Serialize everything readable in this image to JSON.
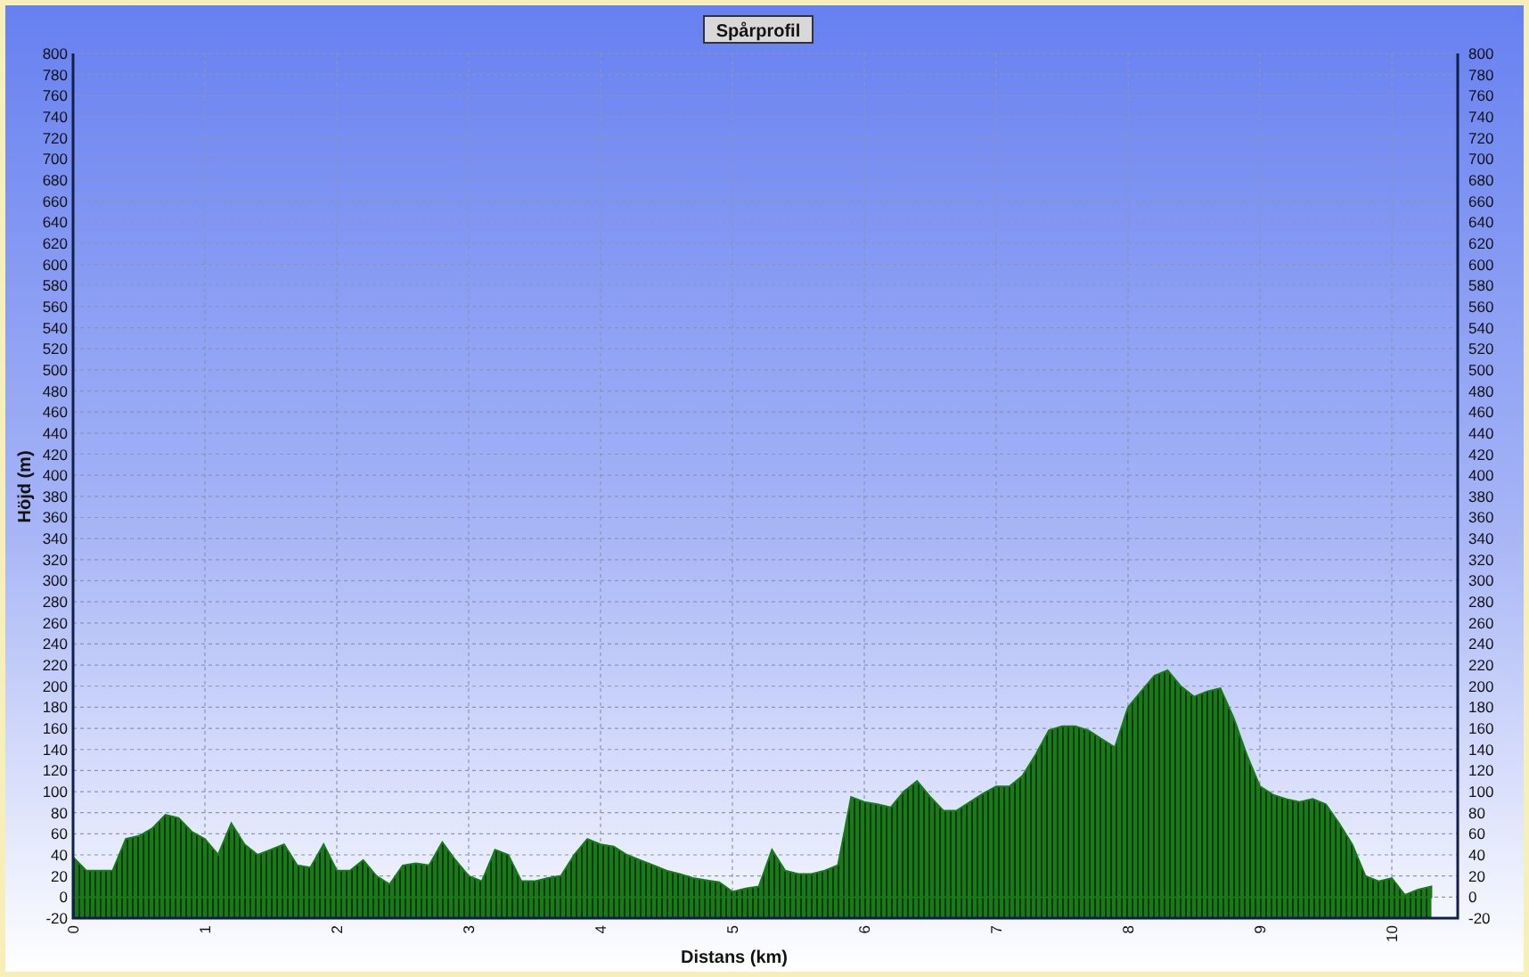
{
  "chart": {
    "right_axis_labels": [
      "800",
      "780",
      "760",
      "740",
      "720",
      "700",
      "680",
      "660",
      "640",
      "620",
      "600",
      "580",
      "560",
      "540",
      "520",
      "500",
      "480",
      "460",
      "440",
      "420",
      "400",
      "380",
      "360",
      "340",
      "320",
      "300",
      "280",
      "260",
      "240",
      "220",
      "200",
      "180",
      "160",
      "140",
      "120",
      "100",
      "80",
      "60",
      "40",
      "20",
      "0",
      "-20"
    ],
    "chart_data": {
      "type": "area",
      "title": "Spårprofil",
      "xlabel": "Distans (km)",
      "ylabel": "Höjd (m)",
      "x": [
        0,
        0.1,
        0.2,
        0.3,
        0.4,
        0.5,
        0.6,
        0.7,
        0.8,
        0.9,
        1,
        1.1,
        1.2,
        1.3,
        1.4,
        1.5,
        1.6,
        1.7,
        1.8,
        1.9,
        2,
        2.1,
        2.2,
        2.3,
        2.4,
        2.5,
        2.6,
        2.7,
        2.8,
        2.9,
        3,
        3.1,
        3.2,
        3.3,
        3.4,
        3.5,
        3.6,
        3.7,
        3.8,
        3.9,
        4,
        4.1,
        4.2,
        4.3,
        4.4,
        4.5,
        4.6,
        4.7,
        4.8,
        4.9,
        5,
        5.1,
        5.2,
        5.3,
        5.4,
        5.5,
        5.6,
        5.7,
        5.8,
        5.9,
        6,
        6.1,
        6.2,
        6.3,
        6.4,
        6.5,
        6.6,
        6.7,
        6.8,
        6.9,
        7,
        7.1,
        7.2,
        7.3,
        7.4,
        7.5,
        7.6,
        7.7,
        7.8,
        7.9,
        8,
        8.1,
        8.2,
        8.3,
        8.4,
        8.5,
        8.6,
        8.7,
        8.8,
        8.9,
        9,
        9.1,
        9.2,
        9.3,
        9.4,
        9.5,
        9.6,
        9.7,
        9.8,
        9.9,
        10,
        10.1,
        10.2,
        10.3
      ],
      "series": [
        {
          "color": "#1a7a1a",
          "values": [
            38,
            25,
            25,
            25,
            55,
            58,
            65,
            78,
            75,
            62,
            55,
            40,
            70,
            50,
            40,
            45,
            50,
            30,
            28,
            50,
            25,
            25,
            35,
            20,
            12,
            30,
            32,
            30,
            52,
            35,
            20,
            15,
            45,
            40,
            15,
            15,
            18,
            20,
            40,
            55,
            50,
            48,
            40,
            35,
            30,
            25,
            22,
            18,
            16,
            14,
            5,
            8,
            10,
            45,
            25,
            22,
            22,
            25,
            30,
            95,
            90,
            88,
            85,
            100,
            110,
            95,
            82,
            82,
            90,
            98,
            105,
            105,
            115,
            135,
            158,
            162,
            162,
            158,
            150,
            142,
            180,
            195,
            210,
            215,
            200,
            190,
            195,
            198,
            170,
            135,
            105,
            97,
            93,
            90,
            93,
            88,
            70,
            50,
            20,
            15,
            18,
            2,
            7,
            10
          ]
        }
      ],
      "xlim": [
        0,
        10.5
      ],
      "ylim": [
        -20,
        800
      ],
      "xticks": [
        0,
        1,
        2,
        3,
        4,
        5,
        6,
        7,
        8,
        9,
        10
      ],
      "grid": true,
      "yticks": [
        -20,
        0,
        20,
        40,
        60,
        80,
        100,
        120,
        140,
        160,
        180,
        200,
        220,
        240,
        260,
        280,
        300,
        320,
        340,
        360,
        380,
        400,
        420,
        440,
        460,
        480,
        500,
        520,
        540,
        560,
        580,
        600,
        620,
        640,
        660,
        680,
        700,
        720,
        740,
        760,
        780,
        800
      ]
    }
  }
}
